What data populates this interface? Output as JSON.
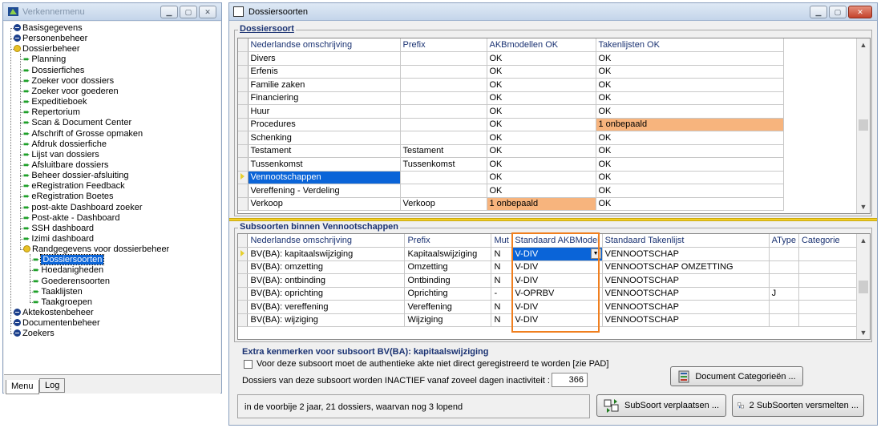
{
  "left_window": {
    "title": "Verkennermenu",
    "tree": {
      "basisgegevens": "Basisgegevens",
      "personenbeheer": "Personenbeheer",
      "dossierbeheer": "Dossierbeheer",
      "dossierbeheer_items": [
        "Planning",
        "Dossierfiches",
        "Zoeker voor dossiers",
        "Zoeker voor goederen",
        "Expeditieboek",
        "Repertorium",
        "Scan & Document Center",
        "Afschrift of Grosse opmaken",
        "Afdruk dossierfiche",
        "Lijst van dossiers",
        "Afsluitbare dossiers",
        "Beheer dossier-afsluiting",
        "eRegistration Feedback",
        "eRegistration Boetes",
        "post-akte Dashboard zoeker",
        "Post-akte - Dashboard",
        "SSH dashboard",
        "Izimi dashboard"
      ],
      "randgegevens": "Randgegevens voor dossierbeheer",
      "randgegevens_items": [
        "Dossiersoorten",
        "Hoedanigheden",
        "Goederensoorten",
        "Taaklijsten",
        "Taakgroepen"
      ],
      "aktekostenbeheer": "Aktekostenbeheer",
      "documentenbeheer": "Documentenbeheer",
      "zoekers": "Zoekers"
    },
    "tabs": [
      "Menu",
      "Log"
    ]
  },
  "right_window": {
    "title": "Dossiersoorten",
    "section1": {
      "label": "Dossiersoort",
      "headers": [
        "Nederlandse omschrijving",
        "Prefix",
        "AKBmodellen OK",
        "Takenlijsten OK"
      ],
      "rows": [
        [
          "Divers",
          "",
          "OK",
          "OK"
        ],
        [
          "Erfenis",
          "",
          "OK",
          "OK"
        ],
        [
          "Familie zaken",
          "",
          "OK",
          "OK"
        ],
        [
          "Financiering",
          "",
          "OK",
          "OK"
        ],
        [
          "Huur",
          "",
          "OK",
          "OK"
        ],
        [
          "Procedures",
          "",
          "OK",
          "1 onbepaald"
        ],
        [
          "Schenking",
          "",
          "OK",
          "OK"
        ],
        [
          "Testament",
          "Testament",
          "OK",
          "OK"
        ],
        [
          "Tussenkomst",
          "Tussenkomst",
          "OK",
          "OK"
        ],
        [
          "Vennootschappen",
          "",
          "OK",
          "OK"
        ],
        [
          "Vereffening - Verdeling",
          "",
          "OK",
          "OK"
        ],
        [
          "Verkoop",
          "Verkoop",
          "1 onbepaald",
          "OK"
        ]
      ],
      "selected_row": 9
    },
    "section2": {
      "label": "Subsoorten binnen Vennootschappen",
      "headers": [
        "Nederlandse omschrijving",
        "Prefix",
        "Mut",
        "Standaard AKBModel",
        "Standaard Takenlijst",
        "AType",
        "Categorie"
      ],
      "rows": [
        [
          "BV(BA): kapitaalswijziging",
          "Kapitaalswijziging",
          "N",
          "V-DIV",
          "VENNOOTSCHAP",
          "",
          ""
        ],
        [
          "BV(BA): omzetting",
          "Omzetting",
          "N",
          "V-DIV",
          "VENNOOTSCHAP OMZETTING",
          "",
          ""
        ],
        [
          "BV(BA): ontbinding",
          "Ontbinding",
          "N",
          "V-DIV",
          "VENNOOTSCHAP",
          "",
          ""
        ],
        [
          "BV(BA): oprichting",
          "Oprichting",
          "-",
          "V-OPRBV",
          "VENNOOTSCHAP",
          "J",
          ""
        ],
        [
          "BV(BA): vereffening",
          "Vereffening",
          "N",
          "V-DIV",
          "VENNOOTSCHAP",
          "",
          ""
        ],
        [
          "BV(BA): wijziging",
          "Wijziging",
          "N",
          "V-DIV",
          "VENNOOTSCHAP",
          "",
          ""
        ]
      ]
    },
    "extra": {
      "title": "Extra kenmerken voor subsoort BV(BA): kapitaalswijziging",
      "checkbox_label": "Voor deze subsoort moet de authentieke akte niet direct geregistreerd te worden [zie PAD]",
      "inactive_label": "Dossiers van deze subsoort worden INACTIEF vanaf zoveel dagen inactiviteit :",
      "inactive_days": "366",
      "doc_cat_button": "Document Categorieën ..."
    },
    "status_text": "in de voorbije 2 jaar, 21 dossiers, waarvan nog 3 lopend",
    "move_button": "SubSoort verplaatsen ...",
    "merge_button": "2 SubSoorten versmelten ..."
  }
}
